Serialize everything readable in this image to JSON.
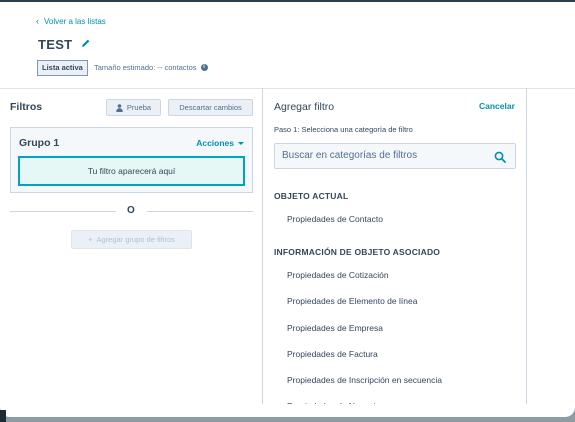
{
  "header": {
    "back_link": "Volver a las listas",
    "title": "TEST",
    "status_badge": "Lista activa",
    "estimate": "Tamaño estimado: -- contactos"
  },
  "left_panel": {
    "title": "Filtros",
    "test_button": "Prueba",
    "discard_button": "Descartar cambios",
    "group": {
      "title": "Grupo 1",
      "actions_label": "Acciones",
      "placeholder": "Tu filtro aparecerá aquí"
    },
    "or_label": "O",
    "add_group_button": "Agregar grupo de filtros"
  },
  "right_panel": {
    "title": "Agregar filtro",
    "cancel": "Cancelar",
    "step": "Paso 1: Selecciona una categoría de filtro",
    "search_placeholder": "Buscar en categorías de filtros",
    "sections": [
      {
        "header": "OBJETO ACTUAL",
        "items": [
          "Propiedades de Contacto"
        ]
      },
      {
        "header": "INFORMACIÓN DE OBJETO ASOCIADO",
        "items": [
          "Propiedades de Cotización",
          "Propiedades de Elemento de línea",
          "Propiedades de Empresa",
          "Propiedades de Factura",
          "Propiedades de Inscripción en secuencia",
          "Propiedades de Negocio"
        ]
      }
    ]
  },
  "colors": {
    "accent": "#0091ae",
    "text": "#33475b",
    "placeholder_border": "#00a4bd",
    "placeholder_bg": "#e5f8f6"
  },
  "icons": [
    "chevron-left-icon",
    "pencil-icon",
    "info-icon",
    "person-icon",
    "chevron-down-icon",
    "plus-icon",
    "search-icon"
  ]
}
